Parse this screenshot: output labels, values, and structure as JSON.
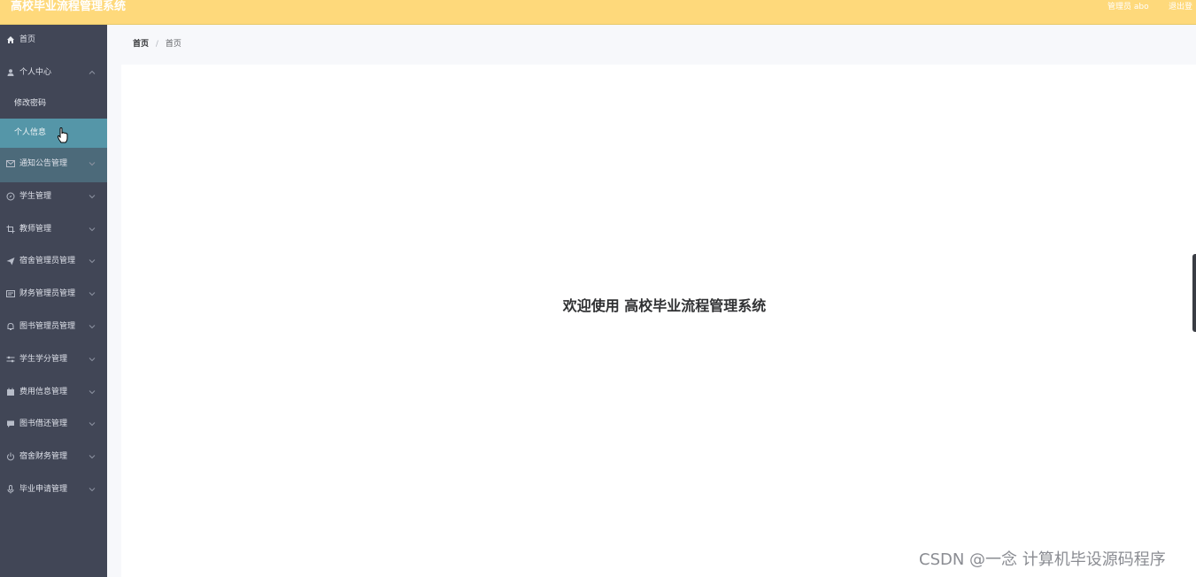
{
  "header": {
    "app_title": "高校毕业流程管理系统",
    "user_label": "管理员 abo",
    "logout_label": "退出登"
  },
  "sidebar": {
    "items": [
      {
        "label": "首页",
        "icon": "home-icon"
      },
      {
        "label": "个人中心",
        "icon": "user-icon",
        "expanded": true,
        "children": [
          {
            "label": "修改密码"
          },
          {
            "label": "个人信息",
            "active": true
          }
        ]
      },
      {
        "label": "通知公告管理",
        "icon": "mail-icon"
      },
      {
        "label": "学生管理",
        "icon": "compass-icon"
      },
      {
        "label": "教师管理",
        "icon": "crop-icon"
      },
      {
        "label": "宿舍管理员管理",
        "icon": "paper-plane-icon"
      },
      {
        "label": "财务管理员管理",
        "icon": "id-card-icon"
      },
      {
        "label": "图书管理员管理",
        "icon": "bell-icon"
      },
      {
        "label": "学生学分管理",
        "icon": "sliders-icon"
      },
      {
        "label": "费用信息管理",
        "icon": "calendar-icon"
      },
      {
        "label": "图书借还管理",
        "icon": "message-icon"
      },
      {
        "label": "宿舍财务管理",
        "icon": "power-icon"
      },
      {
        "label": "毕业申请管理",
        "icon": "microphone-icon"
      }
    ]
  },
  "breadcrumb": {
    "items": [
      "首页",
      "首页"
    ],
    "separator": "/"
  },
  "main": {
    "welcome_text": "欢迎使用 高校毕业流程管理系统"
  },
  "watermark": "CSDN @一念 计算机毕设源码程序",
  "colors": {
    "topbar": "#fed97b",
    "sidebar": "#414656",
    "active_item": "#5596a8",
    "content_bg": "#f7f8fb"
  }
}
